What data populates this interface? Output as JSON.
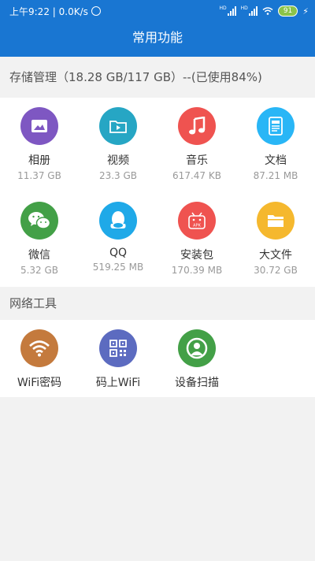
{
  "status_bar": {
    "time_speed": "上午9:22 | 0.0K/s",
    "battery": "91",
    "hd_label": "HD"
  },
  "header": {
    "title": "常用功能"
  },
  "storage": {
    "label": "存储管理（18.28 GB/117 GB）--(已使用84%)",
    "items": [
      {
        "name": "相册",
        "size": "11.37 GB",
        "icon": "photo-icon",
        "color": "#7e57c2"
      },
      {
        "name": "视频",
        "size": "23.3 GB",
        "icon": "video-folder-icon",
        "color": "#26a6c4"
      },
      {
        "name": "音乐",
        "size": "617.47 KB",
        "icon": "music-note-icon",
        "color": "#ef5350"
      },
      {
        "name": "文档",
        "size": "87.21 MB",
        "icon": "document-icon",
        "color": "#29b6f6"
      },
      {
        "name": "微信",
        "size": "5.32 GB",
        "icon": "wechat-icon",
        "color": "#43a047"
      },
      {
        "name": "QQ",
        "size": "519.25 MB",
        "icon": "qq-icon",
        "color": "#1fa9e8"
      },
      {
        "name": "安装包",
        "size": "170.39 MB",
        "icon": "apk-icon",
        "color": "#ef5350"
      },
      {
        "name": "大文件",
        "size": "30.72 GB",
        "icon": "folder-icon",
        "color": "#f5b82e"
      }
    ]
  },
  "network": {
    "label": "网络工具",
    "items": [
      {
        "name": "WiFi密码",
        "icon": "wifi-icon",
        "color": "#c47a3d"
      },
      {
        "name": "码上WiFi",
        "icon": "qr-code-icon",
        "color": "#5c6bc0"
      },
      {
        "name": "设备扫描",
        "icon": "device-scan-icon",
        "color": "#43a047"
      }
    ]
  }
}
